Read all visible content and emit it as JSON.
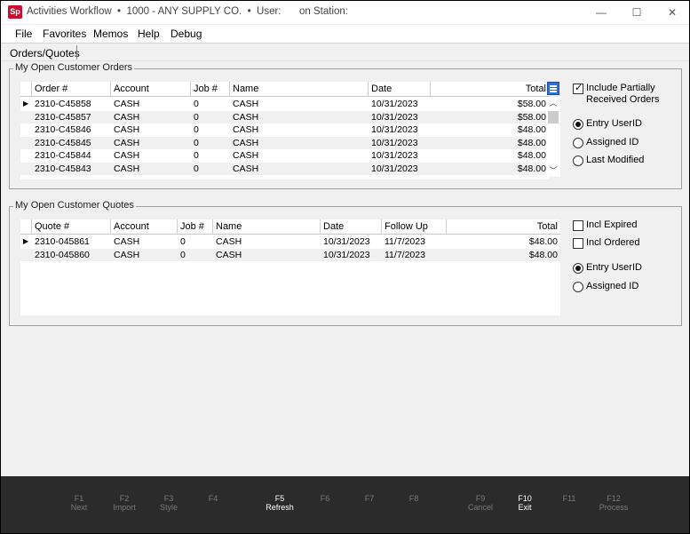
{
  "window": {
    "logo": "Sp",
    "title_main": "Activities Workflow  •  1000 - ANY SUPPLY CO.  •  User:",
    "title_station": "on Station:",
    "min": "—",
    "max": "☐",
    "close": "✕"
  },
  "menu": {
    "items": [
      "File",
      "Favorites",
      "Memos",
      "Help",
      "Debug"
    ]
  },
  "tabs": {
    "active": "Orders/Quotes"
  },
  "orders": {
    "group_title": "My Open Customer Orders",
    "columns": [
      "Order #",
      "Account",
      "Job #",
      "Name",
      "Date",
      "Total"
    ],
    "rows": [
      [
        "2310-C45858",
        "CASH",
        "0",
        "CASH",
        "10/31/2023",
        "$58.00"
      ],
      [
        "2310-C45857",
        "CASH",
        "0",
        "CASH",
        "10/31/2023",
        "$58.00"
      ],
      [
        "2310-C45846",
        "CASH",
        "0",
        "CASH",
        "10/31/2023",
        "$48.00"
      ],
      [
        "2310-C45845",
        "CASH",
        "0",
        "CASH",
        "10/31/2023",
        "$48.00"
      ],
      [
        "2310-C45844",
        "CASH",
        "0",
        "CASH",
        "10/31/2023",
        "$48.00"
      ],
      [
        "2310-C45843",
        "CASH",
        "0",
        "CASH",
        "10/31/2023",
        "$48.00"
      ]
    ],
    "options": {
      "include_partial_label_1": "Include Partially",
      "include_partial_label_2": "Received Orders",
      "include_partial_checked": true,
      "radios": [
        "Entry UserID",
        "Assigned ID",
        "Last Modified"
      ],
      "selected_radio": "Entry UserID"
    }
  },
  "quotes": {
    "group_title": "My Open Customer Quotes",
    "columns": [
      "Quote #",
      "Account",
      "Job #",
      "Name",
      "Date",
      "Follow Up",
      "Total"
    ],
    "rows": [
      [
        "2310-045861",
        "CASH",
        "0",
        "CASH",
        "10/31/2023",
        "11/7/2023",
        "$48.00"
      ],
      [
        "2310-045860",
        "CASH",
        "0",
        "CASH",
        "10/31/2023",
        "11/7/2023",
        "$48.00"
      ]
    ],
    "options": {
      "incl_expired_label": "Incl Expired",
      "incl_expired_checked": false,
      "incl_ordered_label": "Incl Ordered",
      "incl_ordered_checked": false,
      "radios": [
        "Entry UserID",
        "Assigned ID"
      ],
      "selected_radio": "Entry UserID"
    }
  },
  "function_keys": [
    {
      "key": "F1",
      "label": "Next",
      "active": false
    },
    {
      "key": "F2",
      "label": "Import",
      "active": false
    },
    {
      "key": "F3",
      "label": "Style",
      "active": false
    },
    {
      "key": "F4",
      "label": "",
      "active": false
    },
    {
      "key": "F5",
      "label": "Refresh",
      "active": true
    },
    {
      "key": "F6",
      "label": "",
      "active": false
    },
    {
      "key": "F7",
      "label": "",
      "active": false
    },
    {
      "key": "F8",
      "label": "",
      "active": false
    },
    {
      "key": "F9",
      "label": "Cancel",
      "active": false
    },
    {
      "key": "F10",
      "label": "Exit",
      "active": true
    },
    {
      "key": "F11",
      "label": "",
      "active": false
    },
    {
      "key": "F12",
      "label": "Process",
      "active": false
    }
  ],
  "colors": {
    "logo": "#c8102e",
    "column_chooser": "#2f6fd6",
    "fkey_bar": "#2b2b2b"
  }
}
